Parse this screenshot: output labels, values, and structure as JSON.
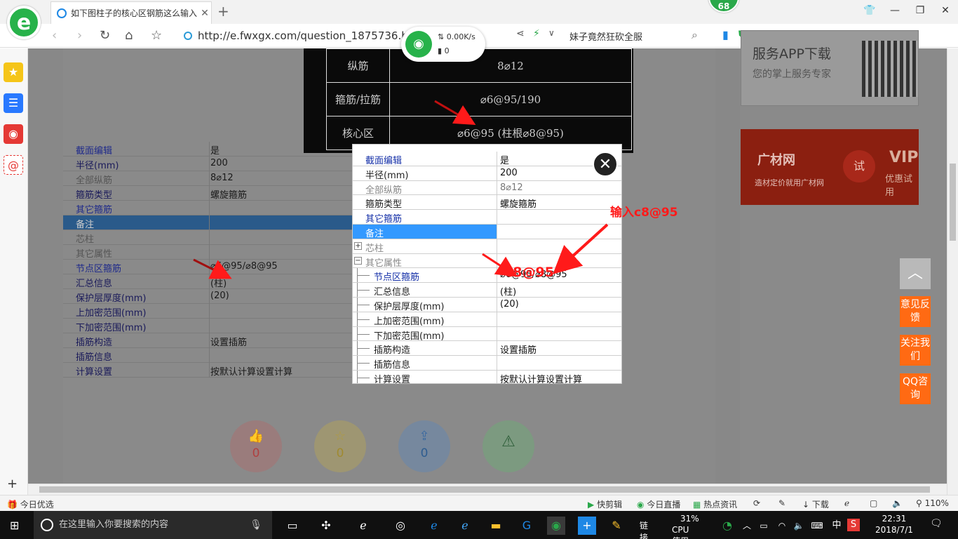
{
  "browser": {
    "tab_title": "如下图柱子的核心区钢筋这么输入",
    "tab_close": "✕",
    "new_tab": "+",
    "badge": "68",
    "url": "http://e.fwxgx.com/question_1875736.h",
    "search_text": "妹子竟然狂砍全服",
    "net_speed": "0.00K/s",
    "net_count": "0",
    "zoom": "110%"
  },
  "dark_image": {
    "rows": [
      {
        "k": "纵筋",
        "v": "8⌀12"
      },
      {
        "k": "箍筋/拉筋",
        "v": "⌀6@95/190"
      },
      {
        "k": "核心区",
        "v": "⌀6@95 (柱根⌀8@95)"
      }
    ]
  },
  "bg_table": {
    "rows": [
      {
        "k": "截面编辑",
        "v": "是",
        "cls": "blue"
      },
      {
        "k": "半径(mm)",
        "v": "200",
        "cls": ""
      },
      {
        "k": "全部纵筋",
        "v": "8⌀12",
        "cls": "grey"
      },
      {
        "k": "箍筋类型",
        "v": "螺旋箍筋",
        "cls": ""
      },
      {
        "k": "其它箍筋",
        "v": "",
        "cls": "blue"
      },
      {
        "k": "备注",
        "v": "",
        "cls": "sel"
      },
      {
        "k": "芯柱",
        "v": "",
        "cls": "grey"
      },
      {
        "k": "其它属性",
        "v": "",
        "cls": "grey"
      },
      {
        "k": "节点区箍筋",
        "v": "⌀6@95/⌀8@95",
        "cls": "blue"
      },
      {
        "k": "汇总信息",
        "v": "(柱)",
        "cls": ""
      },
      {
        "k": "保护层厚度(mm)",
        "v": "(20)",
        "cls": ""
      },
      {
        "k": "上加密范围(mm)",
        "v": "",
        "cls": ""
      },
      {
        "k": "下加密范围(mm)",
        "v": "",
        "cls": ""
      },
      {
        "k": "插筋构造",
        "v": "设置插筋",
        "cls": ""
      },
      {
        "k": "插筋信息",
        "v": "",
        "cls": ""
      },
      {
        "k": "计算设置",
        "v": "按默认计算设置计算",
        "cls": ""
      }
    ]
  },
  "modal": {
    "rows": [
      {
        "k": "截面编辑",
        "v": "是"
      },
      {
        "k": "半径(mm)",
        "v": "200"
      },
      {
        "k": "全部纵筋",
        "v": "8⌀12"
      },
      {
        "k": "箍筋类型",
        "v": "螺旋箍筋"
      },
      {
        "k": "其它箍筋",
        "v": ""
      },
      {
        "k": "备注",
        "v": ""
      },
      {
        "k": "芯柱",
        "v": ""
      },
      {
        "k": "其它属性",
        "v": ""
      },
      {
        "k": "节点区箍筋",
        "v": "⌀6@95/⌀8@95"
      },
      {
        "k": "汇总信息",
        "v": "(柱)"
      },
      {
        "k": "保护层厚度(mm)",
        "v": "(20)"
      },
      {
        "k": "上加密范围(mm)",
        "v": ""
      },
      {
        "k": "下加密范围(mm)",
        "v": ""
      },
      {
        "k": "插筋构造",
        "v": "设置插筋"
      },
      {
        "k": "插筋信息",
        "v": ""
      },
      {
        "k": "计算设置",
        "v": "按默认计算设置计算"
      }
    ],
    "annotation_top": "输入c8@95",
    "annotation_cell": "c8@95",
    "close": "✕"
  },
  "actions": [
    {
      "icon": "👍",
      "count": "0"
    },
    {
      "icon": "☆",
      "count": "0"
    },
    {
      "icon": "⇪",
      "count": "0"
    },
    {
      "icon": "⚠",
      "count": ""
    }
  ],
  "right": {
    "app_title": "服务APP下载",
    "app_sub": "您的掌上服务专家",
    "vip_brand": "广材网",
    "vip_site": "造材定价就用广材网",
    "vip_try": "试",
    "vip_big": "VIP",
    "vip_small": "优惠试用",
    "back_top": "︿",
    "feedback": "意见反馈",
    "follow": "关注我们",
    "qq": "QQ咨询"
  },
  "statusbar": {
    "left": "今日优选",
    "items": [
      "快剪辑",
      "今日直播",
      "热点资讯",
      "下载",
      "110%"
    ]
  },
  "taskbar": {
    "search_placeholder": "在这里输入你要搜索的内容",
    "link": "链接",
    "cpu_pct": "31%",
    "cpu_label": "CPU使用",
    "ime": "中",
    "time": "22:31",
    "date": "2018/7/1"
  },
  "colors": {
    "accent": "#ff6a13",
    "select": "#3399ff",
    "annotation": "#ff1a1a"
  }
}
